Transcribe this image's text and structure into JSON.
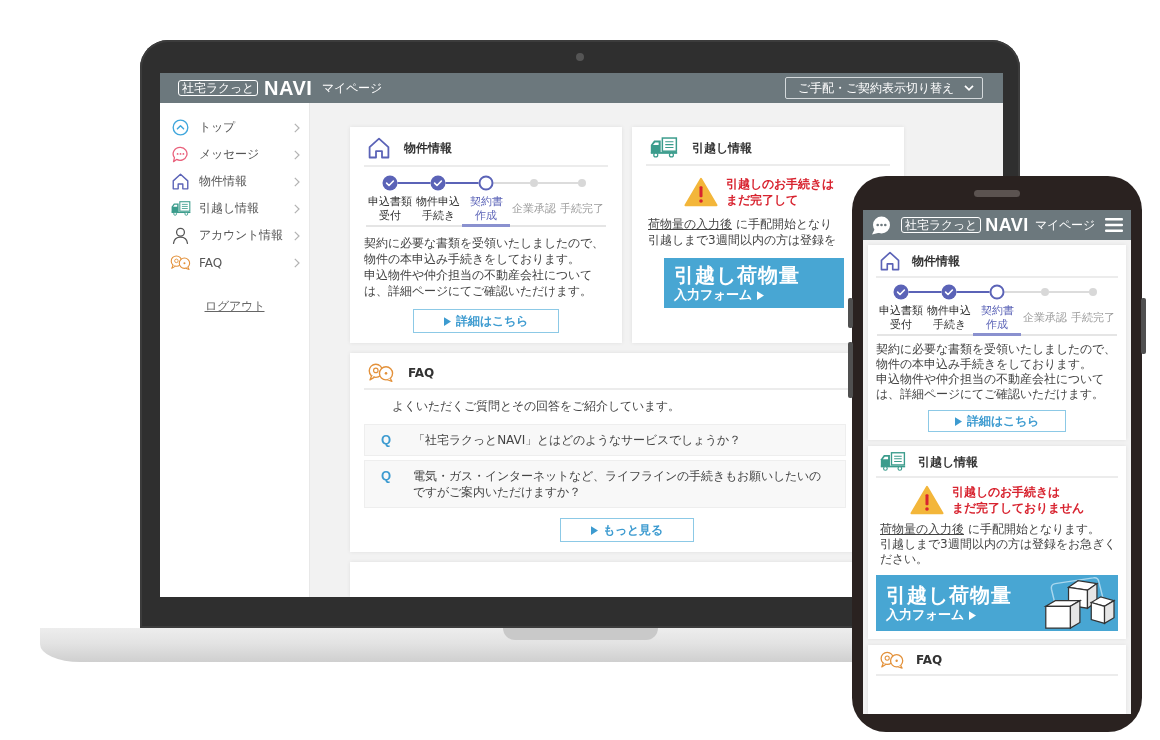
{
  "laptop": {
    "header": {
      "logo_badge": "社宅ラクっと",
      "logo": "NAVI",
      "subtitle": "マイページ",
      "switcher": "ご手配・ご契約表示切り替え"
    },
    "sidebar": {
      "items": [
        {
          "kind": "top",
          "label": "トップ"
        },
        {
          "kind": "message",
          "label": "メッセージ"
        },
        {
          "kind": "property",
          "label": "物件情報"
        },
        {
          "kind": "moving",
          "label": "引越し情報"
        },
        {
          "kind": "account",
          "label": "アカウント情報"
        },
        {
          "kind": "faq",
          "label": "FAQ"
        }
      ],
      "logout": "ログアウト"
    },
    "property_card": {
      "title": "物件情報",
      "steps": [
        {
          "lines": [
            "申込書類",
            "受付"
          ],
          "completed": true,
          "selected": false
        },
        {
          "lines": [
            "物件申込",
            "手続き"
          ],
          "completed": true,
          "selected": false
        },
        {
          "lines": [
            "契約書",
            "作成"
          ],
          "completed": false,
          "selected": true
        },
        {
          "lines": [
            "企業承認"
          ],
          "completed": false,
          "selected": false
        },
        {
          "lines": [
            "手続完了"
          ],
          "completed": false,
          "selected": false
        }
      ],
      "description": [
        "契約に必要な書類を受領いたしましたので、物件の本申込み手続きをしております。",
        "申込物件や仲介担当の不動産会社については、詳細ページにてご確認いただけます。"
      ],
      "button": "詳細はこちら"
    },
    "moving_card": {
      "title": "引越し情報",
      "alert": [
        "引越しのお手続きは",
        "まだ完了して"
      ],
      "note_link": "荷物量の入力後",
      "note": [
        "に手配開始となり",
        "引越しまで3週間以内の方は登録を"
      ],
      "banner": {
        "title": "引越し荷物量",
        "subtitle": "入力フォーム"
      }
    },
    "faq_card": {
      "title": "FAQ",
      "intro": "よくいただくご質問とその回答をご紹介しています。",
      "questions": [
        {
          "marker": "Q",
          "text": "「社宅ラクっとNAVI」とはどのようなサービスでしょうか？"
        },
        {
          "marker": "Q",
          "text": "電気・ガス・インターネットなど、ライフラインの手続きもお願いしたいのですがご案内いただけますか？"
        }
      ],
      "button": "もっと見る"
    }
  },
  "phone": {
    "header": {
      "logo_badge": "社宅ラクっと",
      "logo": "NAVI",
      "subtitle": "マイページ"
    },
    "property_card": {
      "title": "物件情報",
      "steps": [
        {
          "lines": [
            "申込書類",
            "受付"
          ],
          "completed": true,
          "selected": false
        },
        {
          "lines": [
            "物件申込",
            "手続き"
          ],
          "completed": true,
          "selected": false
        },
        {
          "lines": [
            "契約書",
            "作成"
          ],
          "completed": false,
          "selected": true
        },
        {
          "lines": [
            "企業承認"
          ],
          "completed": false,
          "selected": false
        },
        {
          "lines": [
            "手続完了"
          ],
          "completed": false,
          "selected": false
        }
      ],
      "description": [
        "契約に必要な書類を受領いたしましたので、物件の本申込み手続きをしております。",
        "申込物件や仲介担当の不動産会社については、詳細ページにてご確認いただけます。"
      ],
      "button": "詳細はこちら"
    },
    "moving_card": {
      "title": "引越し情報",
      "alert": [
        "引越しのお手続きは",
        "まだ完了しておりません"
      ],
      "note_link": "荷物量の入力後",
      "note": [
        "に手配開始となります。",
        "引越しまで3週間以内の方は登録をお急ぎください。"
      ],
      "banner": {
        "title": "引越し荷物量",
        "subtitle": "入力フォーム"
      }
    },
    "faq_card": {
      "title": "FAQ"
    }
  }
}
